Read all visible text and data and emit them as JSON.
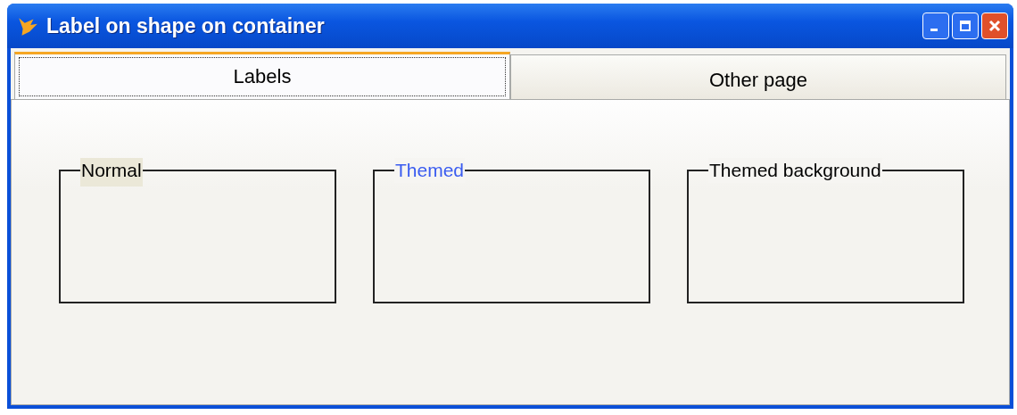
{
  "window": {
    "title": "Label on shape on container"
  },
  "tabs": [
    {
      "label": "Labels",
      "selected": true
    },
    {
      "label": "Other page",
      "selected": false
    }
  ],
  "shapes": [
    {
      "label": "Normal",
      "kind": "normal"
    },
    {
      "label": "Themed",
      "kind": "themed"
    },
    {
      "label": "Themed background",
      "kind": "themed_background"
    }
  ]
}
